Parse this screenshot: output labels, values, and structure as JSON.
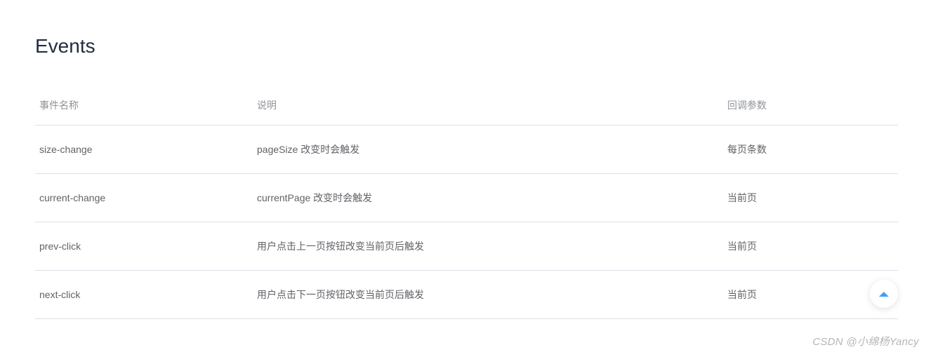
{
  "section": {
    "title": "Events"
  },
  "table": {
    "headers": {
      "name": "事件名称",
      "description": "说明",
      "callback": "回调参数"
    },
    "rows": [
      {
        "name": "size-change",
        "description": "pageSize 改变时会触发",
        "callback": "每页条数"
      },
      {
        "name": "current-change",
        "description": "currentPage 改变时会触发",
        "callback": "当前页"
      },
      {
        "name": "prev-click",
        "description": "用户点击上一页按钮改变当前页后触发",
        "callback": "当前页"
      },
      {
        "name": "next-click",
        "description": "用户点击下一页按钮改变当前页后触发",
        "callback": "当前页"
      }
    ]
  },
  "watermark": "CSDN @小绵杨Yancy"
}
